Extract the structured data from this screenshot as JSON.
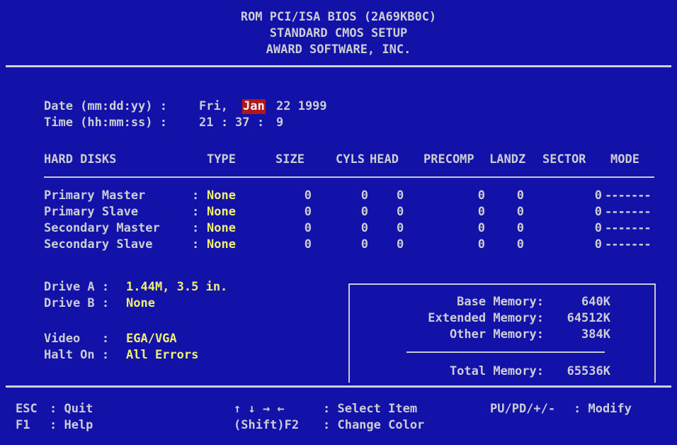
{
  "header": {
    "line1": "ROM PCI/ISA BIOS (2A69KB0C)",
    "line2": "STANDARD CMOS SETUP",
    "line3": "AWARD SOFTWARE, INC."
  },
  "datetime": {
    "date_label": "Date (mm:dd:yy) :",
    "date_day": "Fri,",
    "date_month": "Jan",
    "date_rest": "22 1999",
    "time_label": "Time (hh:mm:ss) :",
    "time_hour": "21",
    "time_minute": "37",
    "time_second": "9"
  },
  "disk_table": {
    "headers": [
      "HARD DISKS",
      "TYPE",
      "SIZE",
      "CYLS",
      "HEAD",
      "PRECOMP",
      "LANDZ",
      "SECTOR",
      "MODE"
    ],
    "rows": [
      {
        "name": "Primary Master",
        "type": "None",
        "size": "0",
        "cyls": "0",
        "head": "0",
        "precomp": "0",
        "landz": "0",
        "sector": "0",
        "mode": "-------"
      },
      {
        "name": "Primary Slave",
        "type": "None",
        "size": "0",
        "cyls": "0",
        "head": "0",
        "precomp": "0",
        "landz": "0",
        "sector": "0",
        "mode": "-------"
      },
      {
        "name": "Secondary Master",
        "type": "None",
        "size": "0",
        "cyls": "0",
        "head": "0",
        "precomp": "0",
        "landz": "0",
        "sector": "0",
        "mode": "-------"
      },
      {
        "name": "Secondary Slave",
        "type": "None",
        "size": "0",
        "cyls": "0",
        "head": "0",
        "precomp": "0",
        "landz": "0",
        "sector": "0",
        "mode": "-------"
      }
    ]
  },
  "drives": {
    "drive_a_label": "Drive A :",
    "drive_a_value": "1.44M, 3.5 in.",
    "drive_b_label": "Drive B :",
    "drive_b_value": "None",
    "video_label": "Video   :",
    "video_value": "EGA/VGA",
    "halt_label": "Halt On :",
    "halt_value": "All Errors"
  },
  "memory": {
    "base_label": "Base Memory:",
    "base_value": "640K",
    "extended_label": "Extended Memory:",
    "extended_value": "64512K",
    "other_label": "Other Memory:",
    "other_value": "384K",
    "total_label": "Total Memory:",
    "total_value": "65536K"
  },
  "footer": {
    "esc_key": "ESC",
    "esc_action": ": Quit",
    "f1_key": "F1",
    "f1_action": ": Help",
    "arrows_key": "↑ ↓ → ←",
    "arrows_action": ": Select Item",
    "shiftf2_key": "(Shift)F2",
    "shiftf2_action": ": Change Color",
    "pupd_key": "PU/PD/+/-",
    "pupd_action": ": Modify"
  }
}
